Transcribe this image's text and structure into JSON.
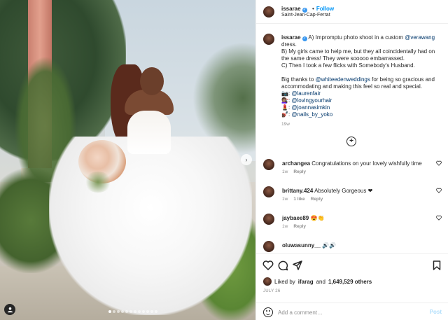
{
  "post": {
    "username": "issarae",
    "follow_label": "Follow",
    "location": "Saint-Jean-Cap-Ferrat",
    "dot": "•"
  },
  "caption": {
    "username": "issarae",
    "line_a_pre": "A) Impromptu photo shoot in a custom ",
    "line_a_mention": "@verawang",
    "line_a_post": " dress.",
    "line_b": "B) My girls came to help me, but they all coincidentally had on the same dress! They were sooooo embarrassed.",
    "line_c": "C) Then I took a few flicks with Somebody's Husband.",
    "thanks_pre": "Big thanks to ",
    "thanks_mention": "@whiteedenweddings",
    "thanks_post": " for being so gracious and accommodating and making this feel so real and special.",
    "credits": [
      {
        "prefix": "📷: ",
        "mention": "@laurenfair"
      },
      {
        "prefix": "💇🏽‍♀️: ",
        "mention": "@lovingyourhair"
      },
      {
        "prefix": "💄: ",
        "mention": "@joannasimkin"
      },
      {
        "prefix": "💅🏿: ",
        "mention": "@nails_by_yoko"
      }
    ],
    "age": "19w"
  },
  "load_more_label": "+",
  "comments": [
    {
      "username": "archangea",
      "text": "Congratulations on your lovely wishfully time",
      "age": "1w",
      "likes": "",
      "reply": "Reply"
    },
    {
      "username": "brittany.424",
      "text": "Absolutely Gorgeous ❤",
      "age": "1w",
      "likes": "1 like",
      "reply": "Reply"
    },
    {
      "username": "jaybaee89",
      "text": "😍👏",
      "age": "1w",
      "likes": "",
      "reply": "Reply"
    },
    {
      "username": "oluwasunny__",
      "text": "🔊🔊",
      "age": "",
      "likes": "",
      "reply": ""
    }
  ],
  "likes": {
    "liked_by": "Liked by",
    "liker": "ifarag",
    "and": "and",
    "others": "1,649,529 others"
  },
  "date": "JULY 26",
  "add_comment": {
    "placeholder": "Add a comment…",
    "post_label": "Post"
  },
  "icons": {
    "more": "more-icon",
    "heart": "heart-icon",
    "comment": "comment-icon",
    "share": "share-icon",
    "save": "bookmark-icon",
    "emoji": "emoji-icon",
    "next": "chevron-right-icon",
    "tag": "user-tag-icon"
  },
  "colors": {
    "link": "#0095f6",
    "mention": "#00376b",
    "muted": "#8e8e8e",
    "post_disabled": "#b2dffc"
  }
}
